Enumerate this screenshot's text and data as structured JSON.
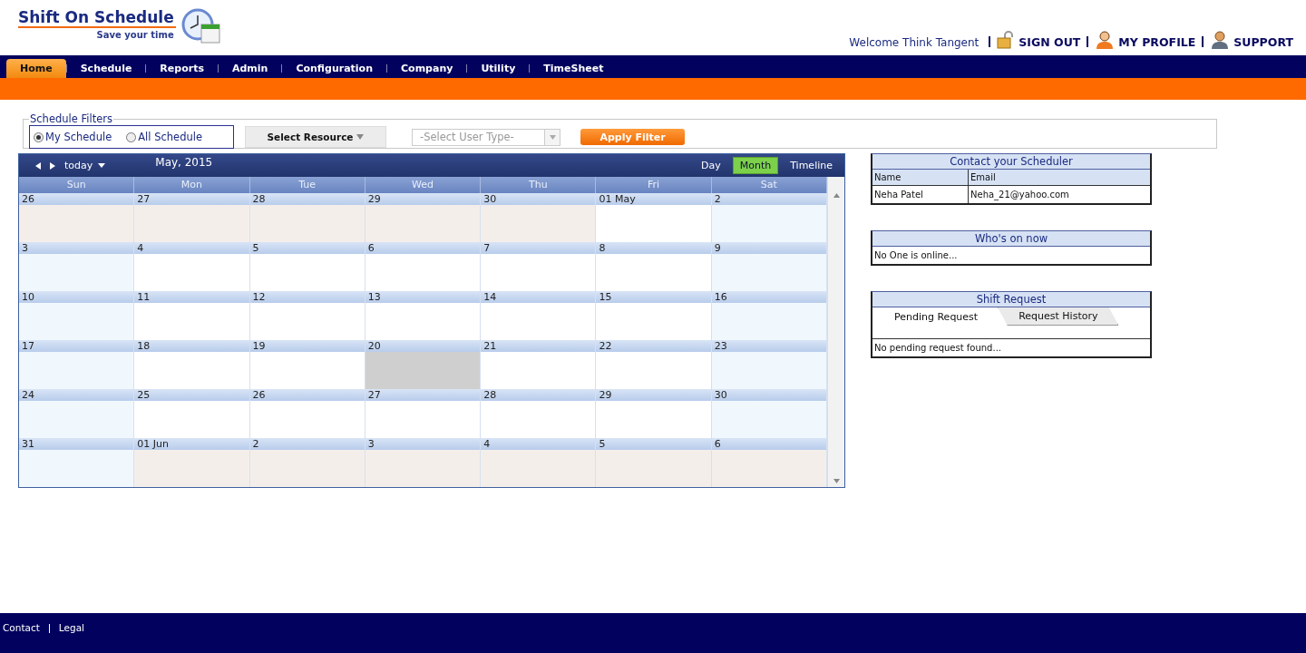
{
  "brand": {
    "title": "Shift On Schedule",
    "tagline": "Save your time"
  },
  "user_bar": {
    "welcome": "Welcome Think Tangent",
    "links": [
      {
        "label": "SIGN OUT",
        "kind": "lock"
      },
      {
        "label": "MY PROFILE",
        "kind": "person"
      },
      {
        "label": "SUPPORT",
        "kind": "headset"
      }
    ]
  },
  "nav": [
    {
      "label": "Home",
      "selected": true
    },
    {
      "label": "Schedule",
      "selected": false
    },
    {
      "label": "Reports",
      "selected": false
    },
    {
      "label": "Admin",
      "selected": false
    },
    {
      "label": "Configuration",
      "selected": false
    },
    {
      "label": "Company",
      "selected": false
    },
    {
      "label": "Utility",
      "selected": false
    },
    {
      "label": "TimeSheet",
      "selected": false
    }
  ],
  "filters": {
    "title": "Schedule Filters",
    "scope": [
      {
        "label": "My Schedule",
        "selected": true
      },
      {
        "label": "All Schedule",
        "selected": false
      }
    ],
    "resource_button": "Select Resource",
    "user_type": {
      "value": "-Select User Type-",
      "disabled": true
    },
    "apply_button": "Apply Filter"
  },
  "calendar": {
    "today_button": "today",
    "title": "May, 2015",
    "views": [
      {
        "label": "Day",
        "selected": false
      },
      {
        "label": "Month",
        "selected": true
      },
      {
        "label": "Timeline",
        "selected": false
      }
    ],
    "weekdays": [
      "Sun",
      "Mon",
      "Tue",
      "Wed",
      "Thu",
      "Fri",
      "Sat"
    ],
    "weeks": [
      [
        {
          "label": "26",
          "kind": "outside"
        },
        {
          "label": "27",
          "kind": "outside"
        },
        {
          "label": "28",
          "kind": "outside"
        },
        {
          "label": "29",
          "kind": "outside"
        },
        {
          "label": "30",
          "kind": "outside"
        },
        {
          "label": "01 May",
          "kind": "current"
        },
        {
          "label": "2",
          "kind": "current"
        }
      ],
      [
        {
          "label": "3",
          "kind": "current"
        },
        {
          "label": "4",
          "kind": "current"
        },
        {
          "label": "5",
          "kind": "current"
        },
        {
          "label": "6",
          "kind": "current"
        },
        {
          "label": "7",
          "kind": "current"
        },
        {
          "label": "8",
          "kind": "current"
        },
        {
          "label": "9",
          "kind": "current"
        }
      ],
      [
        {
          "label": "10",
          "kind": "current"
        },
        {
          "label": "11",
          "kind": "current"
        },
        {
          "label": "12",
          "kind": "current"
        },
        {
          "label": "13",
          "kind": "current"
        },
        {
          "label": "14",
          "kind": "current"
        },
        {
          "label": "15",
          "kind": "current"
        },
        {
          "label": "16",
          "kind": "current"
        }
      ],
      [
        {
          "label": "17",
          "kind": "current"
        },
        {
          "label": "18",
          "kind": "current"
        },
        {
          "label": "19",
          "kind": "current"
        },
        {
          "label": "20",
          "kind": "today"
        },
        {
          "label": "21",
          "kind": "current"
        },
        {
          "label": "22",
          "kind": "current"
        },
        {
          "label": "23",
          "kind": "current"
        }
      ],
      [
        {
          "label": "24",
          "kind": "current"
        },
        {
          "label": "25",
          "kind": "current"
        },
        {
          "label": "26",
          "kind": "current"
        },
        {
          "label": "27",
          "kind": "current"
        },
        {
          "label": "28",
          "kind": "current"
        },
        {
          "label": "29",
          "kind": "current"
        },
        {
          "label": "30",
          "kind": "current"
        }
      ],
      [
        {
          "label": "31",
          "kind": "current"
        },
        {
          "label": "01 Jun",
          "kind": "outside"
        },
        {
          "label": "2",
          "kind": "outside"
        },
        {
          "label": "3",
          "kind": "outside"
        },
        {
          "label": "4",
          "kind": "outside"
        },
        {
          "label": "5",
          "kind": "outside"
        },
        {
          "label": "6",
          "kind": "outside"
        }
      ]
    ]
  },
  "contact": {
    "title": "Contact your Scheduler",
    "columns": [
      "Name",
      "Email"
    ],
    "rows": [
      [
        "Neha Patel",
        "Neha_21@yahoo.com"
      ]
    ]
  },
  "whos_on": {
    "title": "Who's on now",
    "message": "No One is online..."
  },
  "shift_request": {
    "title": "Shift Request",
    "tabs": [
      {
        "label": "Pending Request",
        "selected": true
      },
      {
        "label": "Request History",
        "selected": false
      }
    ],
    "message": "No pending request found..."
  },
  "footer": {
    "links": [
      "Contact",
      "Legal"
    ]
  }
}
